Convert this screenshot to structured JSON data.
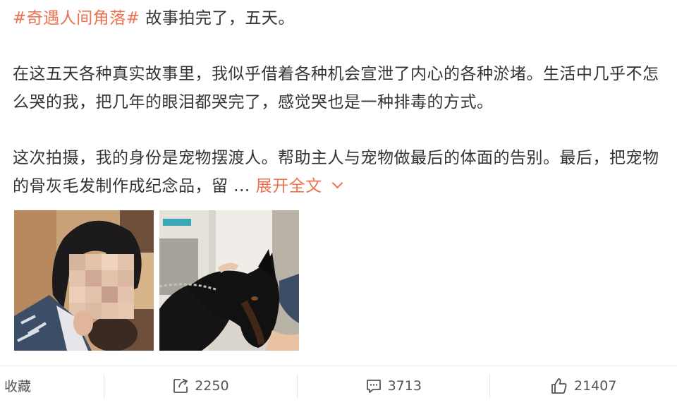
{
  "post": {
    "hashtag": "#奇遇人间角落#",
    "title_rest": " 故事拍完了，五天。",
    "paragraph2": "在这五天各种真实故事里，我似乎借着各种机会宣泄了内心的各种淤堵。生活中几乎不怎么哭的我，把几年的眼泪都哭完了，感觉哭也是一种排毒的方式。",
    "paragraph3": "这次拍摄，我的身份是宠物摆渡人。帮助主人与宠物做最后的体面的告别。最后，把宠物的骨灰毛发制作成纪念品，留 ... ",
    "expand_label": "展开全文"
  },
  "images": [
    {
      "icon": "woman-photo-blurred-face"
    },
    {
      "icon": "doberman-dog-photo"
    }
  ],
  "actions": {
    "favorite_label": "收藏",
    "repost_count": "2250",
    "comment_count": "3713",
    "like_count": "21407"
  },
  "colors": {
    "accent": "#eb7350",
    "text": "#333333",
    "muted": "#555555"
  }
}
